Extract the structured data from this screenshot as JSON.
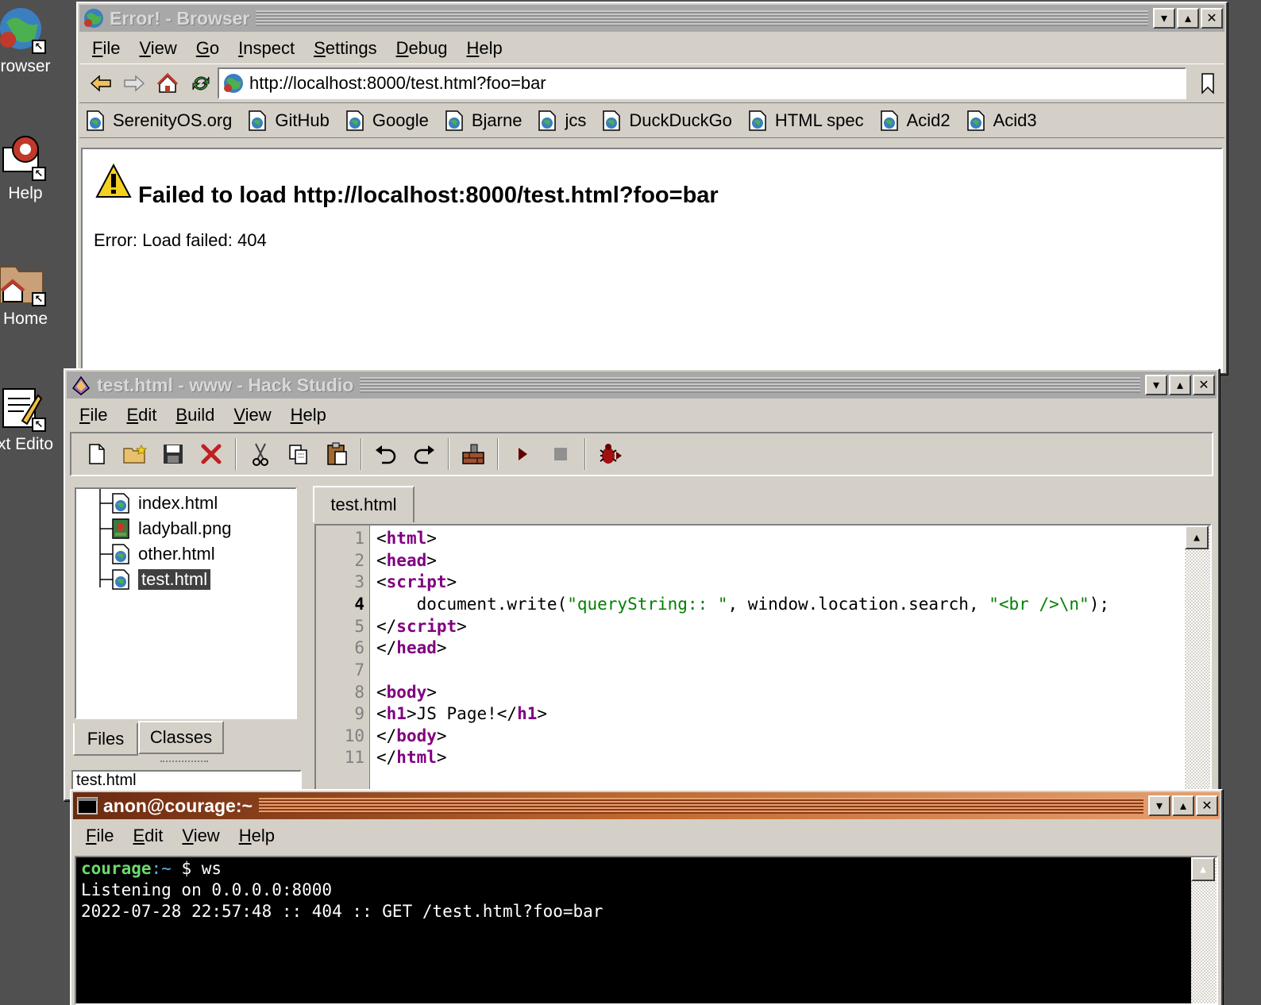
{
  "desktop": {
    "icons": [
      {
        "label": "rowser",
        "icon": "browser-icon"
      },
      {
        "label": "Help",
        "icon": "help-icon"
      },
      {
        "label": "Home",
        "icon": "home-folder-icon"
      },
      {
        "label": "xt Edito",
        "icon": "text-editor-icon"
      }
    ]
  },
  "browser": {
    "title": "Error! - Browser",
    "menu": [
      "File",
      "View",
      "Go",
      "Inspect",
      "Settings",
      "Debug",
      "Help"
    ],
    "url": "http://localhost:8000/test.html?foo=bar",
    "bookmarks": [
      "SerenityOS.org",
      "GitHub",
      "Google",
      "Bjarne",
      "jcs",
      "DuckDuckGo",
      "HTML spec",
      "Acid2",
      "Acid3"
    ],
    "page": {
      "heading": "Failed to load http://localhost:8000/test.html?foo=bar",
      "message": "Error: Load failed: 404"
    }
  },
  "hackstudio": {
    "title": "test.html - www - Hack Studio",
    "menu": [
      "File",
      "Edit",
      "Build",
      "View",
      "Help"
    ],
    "files": [
      "index.html",
      "ladyball.png",
      "other.html",
      "test.html"
    ],
    "selected_file": "test.html",
    "left_tabs": [
      "Files",
      "Classes"
    ],
    "bottom_combo": "test.html",
    "editor_tab": "test.html",
    "current_line": 4,
    "line_numbers": [
      "1",
      "2",
      "3",
      "4",
      "5",
      "6",
      "7",
      "8",
      "9",
      "10",
      "11"
    ],
    "code": {
      "l1_kw": "html",
      "l2_kw": "head",
      "l3_kw": "script",
      "l4_a": "    document.write(",
      "l4_s1": "\"queryString:: \"",
      "l4_b": ", window.location.search, ",
      "l4_s2": "\"<br />\\n\"",
      "l4_c": ");",
      "l5_kw": "script",
      "l6_kw": "head",
      "l8_kw": "body",
      "l9_kw1": "h1",
      "l9_text": "JS Page!",
      "l9_kw2": "h1",
      "l10_kw": "body",
      "l11_kw": "html"
    }
  },
  "terminal": {
    "title": "anon@courage:~",
    "menu": [
      "File",
      "Edit",
      "View",
      "Help"
    ],
    "prompt_host": "courage",
    "prompt_path": ":~",
    "prompt_symbol": " $ ",
    "command": "ws",
    "output": [
      "Listening on 0.0.0.0:8000",
      "2022-07-28 22:57:48 :: 404 :: GET /test.html?foo=bar"
    ]
  },
  "window_buttons": {
    "minimize": "▾",
    "maximize": "▴",
    "close": "✕"
  }
}
